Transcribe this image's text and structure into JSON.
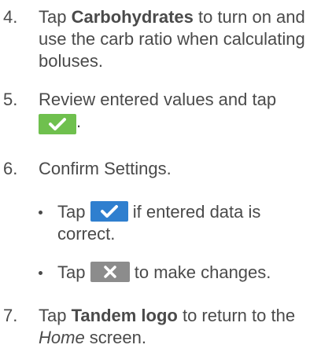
{
  "steps": [
    {
      "number": "4.",
      "pre": "Tap ",
      "bold": "Carbohydrates",
      "post": " to turn on and use the carb ratio when calculating boluses."
    },
    {
      "number": "5.",
      "pre": "Review entered values and tap",
      "button_icon": "green-check-button",
      "post": "."
    },
    {
      "number": "6.",
      "text": "Confirm Settings.",
      "bullets": [
        {
          "pre": "Tap",
          "button_icon": "blue-check-button",
          "post": "if entered data is correct."
        },
        {
          "pre": "Tap",
          "button_icon": "gray-x-button",
          "post": "to make changes."
        }
      ]
    },
    {
      "number": "7.",
      "pre": "Tap ",
      "bold": "Tandem logo",
      "mid": " to return to the ",
      "italic": "Home",
      "post": " screen."
    }
  ],
  "colors": {
    "text": "#4a4a4a",
    "green_button": "#6fc04e",
    "blue_button": "#2f7fcf",
    "gray_button": "#8c8c8c"
  }
}
